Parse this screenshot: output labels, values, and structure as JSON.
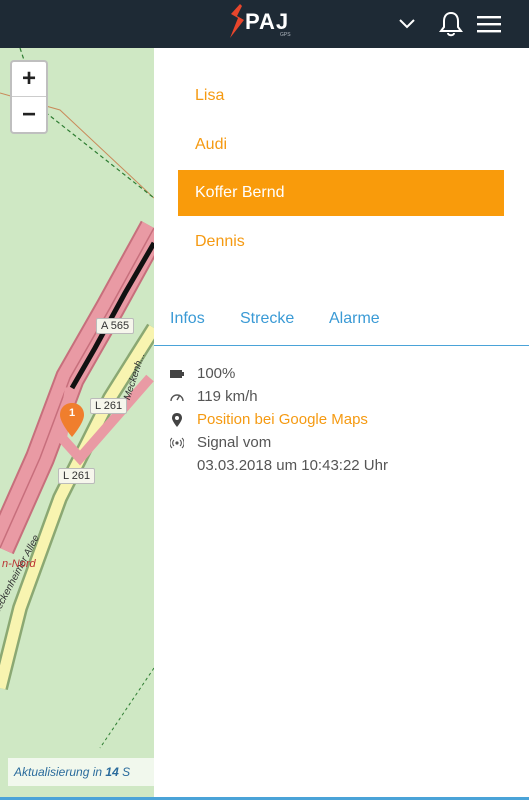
{
  "header": {
    "logo_text": "PAJ",
    "logo_sub": "GPS",
    "icons": [
      "chevron-down-icon",
      "bell-icon",
      "hamburger-menu-icon"
    ],
    "background": "#1e2a35"
  },
  "map": {
    "zoom_in": "+",
    "zoom_out": "−",
    "road_labels": [
      "A 565",
      "L 261",
      "L 261"
    ],
    "street_1": "Meckenheimer Allee",
    "street_2": "Meckenh...",
    "place": "n-Nord",
    "marker_number": "1",
    "update_prefix": "Aktualisierung in",
    "update_seconds": "14",
    "update_suffix": "S"
  },
  "devices": [
    {
      "label": "Lisa",
      "active": false
    },
    {
      "label": "Audi",
      "active": false
    },
    {
      "label": "Koffer Bernd",
      "active": true
    },
    {
      "label": "Dennis",
      "active": false
    }
  ],
  "tabs": [
    "Infos",
    "Strecke",
    "Alarme"
  ],
  "info": {
    "battery": "100%",
    "speed": "119 km/h",
    "position_link": "Position bei Google Maps",
    "signal_label": "Signal vom",
    "signal_time": "03.03.2018 um 10:43:22 Uhr"
  },
  "colors": {
    "accent": "#f99b0b",
    "tab_blue": "#3a9ad5",
    "map_green": "#cfe8c4",
    "motorway": "#e99aa4"
  }
}
